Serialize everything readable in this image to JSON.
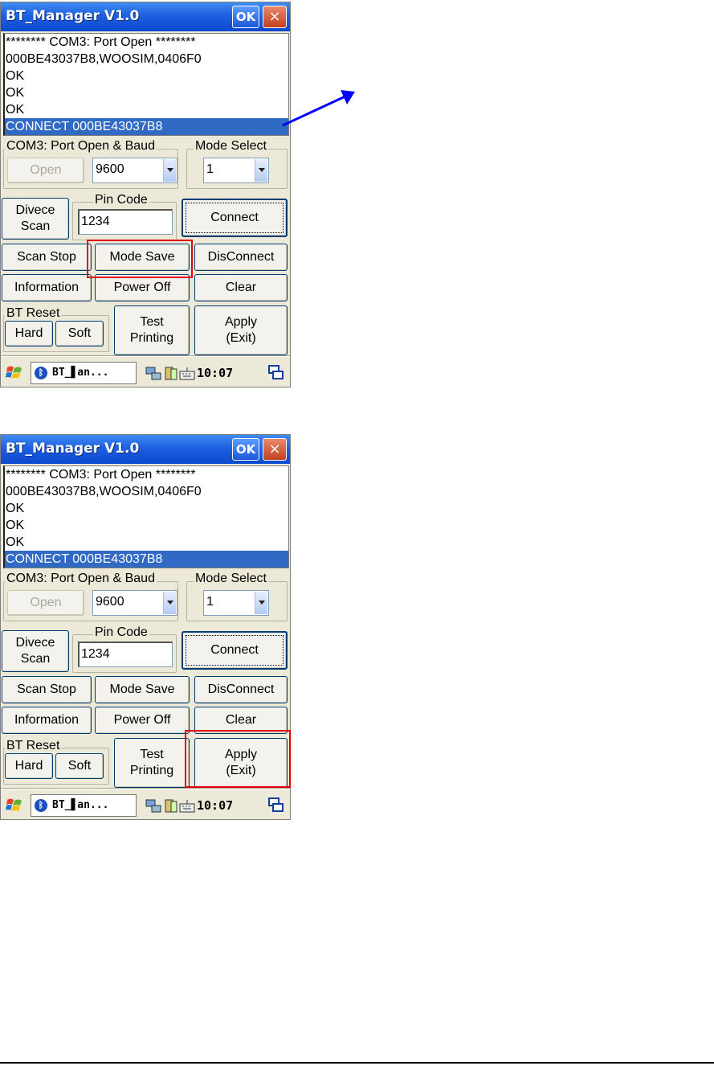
{
  "window_title": "BT_Manager V1.0",
  "ok_label": "OK",
  "close_label": "×",
  "log_lines": [
    "******** COM3: Port Open ********",
    "000BE43037B8,WOOSIM,0406F0",
    "OK",
    "OK",
    "OK",
    "CONNECT 000BE43037B8"
  ],
  "log_selected_index": 5,
  "port_group_label": "COM3: Port Open & Baud",
  "open_label": "Open",
  "baud_value": "9600",
  "mode_group_label": "Mode Select",
  "mode_value": "1",
  "device_scan_label": "Divece\nScan",
  "pin_group_label": "Pin Code",
  "pin_value": "1234",
  "connect_label": "Connect",
  "scan_stop_label": "Scan Stop",
  "mode_save_label": "Mode Save",
  "disconnect_label": "DisConnect",
  "information_label": "Information",
  "power_off_label": "Power Off",
  "clear_label": "Clear",
  "bt_reset_label": "BT Reset",
  "hard_label": "Hard",
  "soft_label": "Soft",
  "test_printing_label": "Test\nPrinting",
  "apply_label": "Apply\n(Exit)",
  "taskbar_app_label": "BT_▋an...",
  "clock": "10:07",
  "highlight_color": "#e00000",
  "arrow_color": "#0000ff",
  "screens": [
    {
      "highlighted_button": "mode-save-button"
    },
    {
      "highlighted_button": "apply-exit-button"
    }
  ]
}
